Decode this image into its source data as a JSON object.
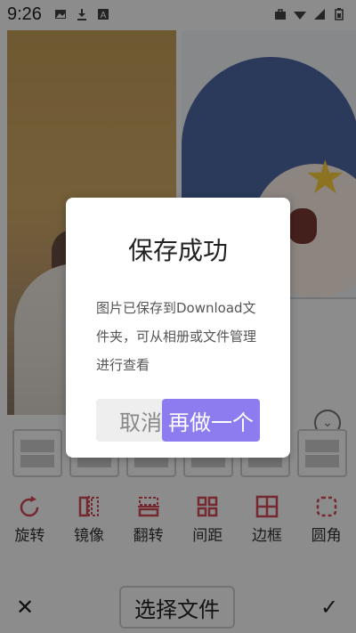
{
  "status_bar": {
    "time": "9:26",
    "left_icons": [
      "image-icon",
      "download-icon",
      "a-icon"
    ],
    "right_icons": [
      "briefcase-icon",
      "wifi-icon",
      "signal-icon",
      "battery-icon"
    ]
  },
  "canvas": {
    "accent_color": "#d64a57"
  },
  "tools": [
    {
      "label": "旋转",
      "icon": "rotate-icon"
    },
    {
      "label": "镜像",
      "icon": "mirror-icon"
    },
    {
      "label": "翻转",
      "icon": "flip-icon"
    },
    {
      "label": "间距",
      "icon": "spacing-icon"
    },
    {
      "label": "边框",
      "icon": "border-icon"
    },
    {
      "label": "圆角",
      "icon": "rounded-corner-icon"
    }
  ],
  "bottom_bar": {
    "close_label": "✕",
    "choose_file_label": "选择文件",
    "confirm_label": "✓"
  },
  "dialog": {
    "title": "保存成功",
    "message": "图片已保存到Download文件夹，可从相册或文件管理进行查看",
    "cancel_label": "取消",
    "again_label": "再做一个",
    "again_color": "#8c7cf0"
  }
}
